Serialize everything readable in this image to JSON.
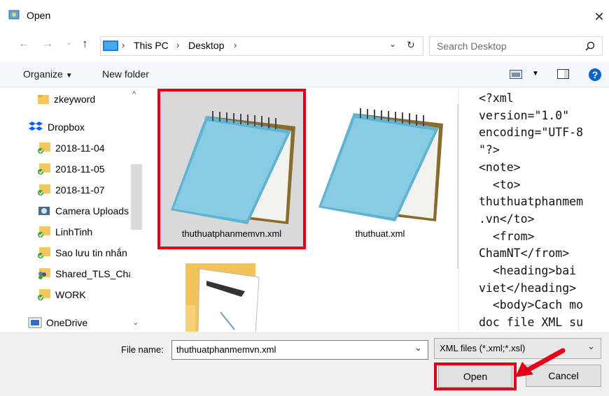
{
  "window": {
    "title": "Open"
  },
  "address": {
    "parts": [
      "This PC",
      "Desktop"
    ]
  },
  "search": {
    "placeholder": "Search Desktop"
  },
  "toolbar": {
    "organize": "Organize",
    "new_folder": "New folder"
  },
  "nav_items": [
    {
      "label": "zkeyword",
      "icon": "folder-icon"
    },
    {
      "label": "Dropbox",
      "icon": "dropbox-icon"
    },
    {
      "label": "2018-11-04",
      "icon": "synced-folder-icon"
    },
    {
      "label": "2018-11-05",
      "icon": "synced-folder-icon"
    },
    {
      "label": "2018-11-07",
      "icon": "synced-folder-icon"
    },
    {
      "label": "Camera Uploads",
      "icon": "camera-folder-icon"
    },
    {
      "label": "LinhTinh",
      "icon": "synced-folder-icon"
    },
    {
      "label": "Sao lưu tin nhắn",
      "icon": "synced-folder-icon"
    },
    {
      "label": "Shared_TLS_Cha",
      "icon": "shared-folder-icon"
    },
    {
      "label": "WORK",
      "icon": "synced-folder-icon"
    },
    {
      "label": "OneDrive",
      "icon": "onedrive-icon"
    }
  ],
  "files": [
    {
      "name": "thuthuatphanmemvn.xml",
      "type": "notepad",
      "selected": true
    },
    {
      "name": "thuthuat.xml",
      "type": "notepad",
      "selected": false
    },
    {
      "name": "",
      "type": "folder",
      "selected": false
    }
  ],
  "preview_text": "<?xml\nversion=\"1.0\"\nencoding=\"UTF-8\n\"?>\n<note>\n  <to>\nthuthuatphanmem\n.vn</to>\n  <from>\nChamNT</from>\n  <heading>bai\nviet</heading>\n  <body>Cach mo\ndoc file XML su",
  "bottom": {
    "file_name_label": "File name:",
    "file_name_value": "thuthuatphanmemvn.xml",
    "filter": "XML files (*.xml;*.xsl)",
    "open": "Open",
    "cancel": "Cancel"
  },
  "colors": {
    "highlight": "#e3001b",
    "accent": "#0078d7"
  }
}
